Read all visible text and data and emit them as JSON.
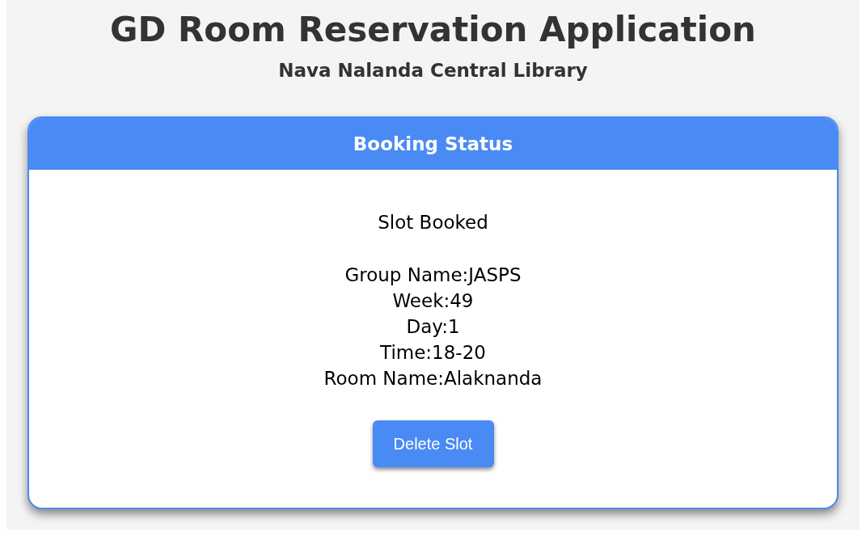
{
  "title": "GD Room Reservation Application",
  "subtitle": "Nava Nalanda Central Library",
  "card": {
    "header": "Booking Status",
    "status": "Slot Booked",
    "details": [
      "Group Name:JASPS",
      "Week:49",
      "Day:1",
      "Time:18-20",
      "Room Name:Alaknanda"
    ],
    "button": "Delete Slot"
  }
}
